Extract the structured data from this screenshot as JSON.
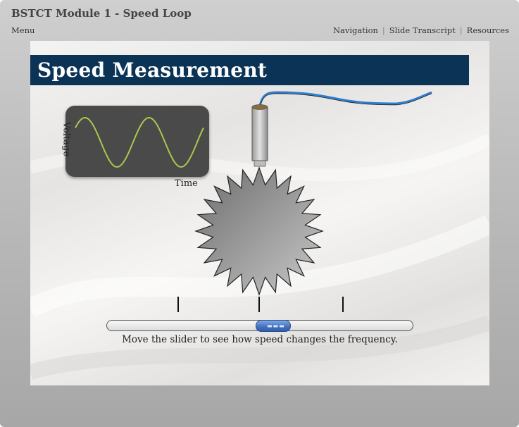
{
  "player": {
    "title": "BSTCT Module 1 - Speed Loop",
    "menu_label": "Menu",
    "nav": [
      {
        "label": "Navigation"
      },
      {
        "label": "Slide Transcript"
      },
      {
        "label": "Resources"
      }
    ]
  },
  "slide": {
    "title": "Speed Measurement",
    "oscilloscope": {
      "y_label": "Voltage",
      "x_label": "Time",
      "trace_color": "#a8c84a"
    },
    "slider": {
      "position_fraction": 0.55,
      "caption": "Move the slider to see how speed changes the frequency."
    }
  },
  "colors": {
    "banner": "#0b3356",
    "slider_thumb": "#3f6fbf",
    "sensor_cable": "#2f7fd0"
  },
  "icons": [
    "sensor-probe-icon",
    "gear-icon",
    "slider-grip-icon"
  ]
}
